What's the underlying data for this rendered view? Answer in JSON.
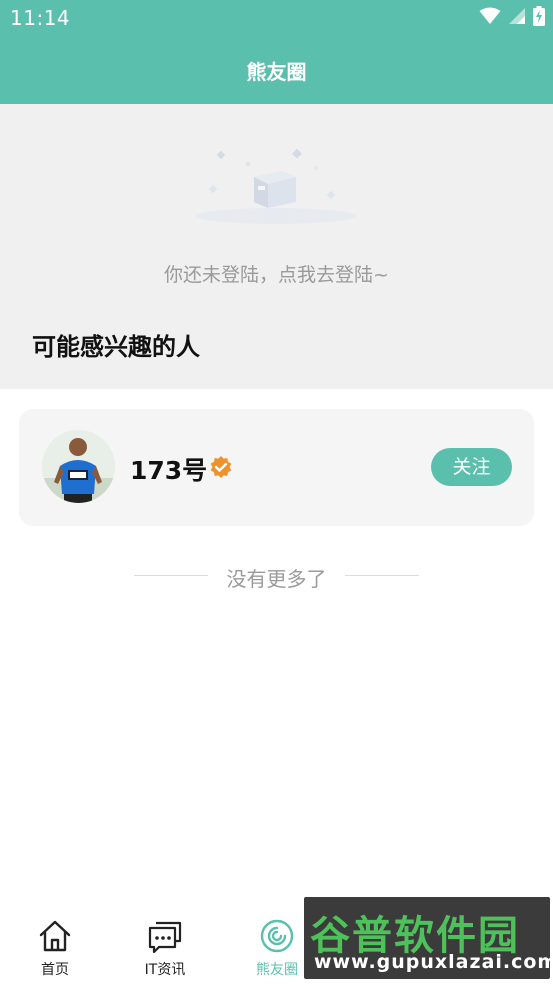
{
  "status_bar": {
    "time": "11:14"
  },
  "header": {
    "title": "熊友圈"
  },
  "empty_state": {
    "message": "你还未登陆，点我去登陆~"
  },
  "recommend": {
    "section_title": "可能感兴趣的人",
    "users": [
      {
        "name": "173号",
        "follow_label": "关注"
      }
    ]
  },
  "list_footer": {
    "no_more": "没有更多了"
  },
  "tabbar": {
    "items": [
      {
        "label": "首页",
        "icon": "home-icon"
      },
      {
        "label": "IT资讯",
        "icon": "chat-bubbles-icon"
      },
      {
        "label": "熊友圈",
        "icon": "circle-feed-icon",
        "active": true
      },
      {
        "label": "",
        "icon": "tab-icon"
      },
      {
        "label": "",
        "icon": "tab-icon"
      }
    ]
  },
  "watermark": {
    "title": "谷普软件园",
    "url": "www.gupuxlazai.com"
  },
  "colors": {
    "accent": "#5bbfad",
    "background_gray": "#f0f0f0",
    "card": "#f5f5f5",
    "verified": "#f0922b"
  }
}
